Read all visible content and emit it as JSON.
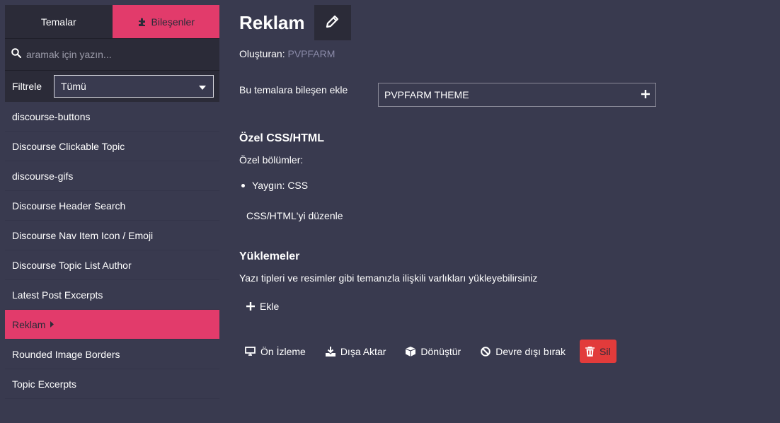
{
  "sidebar": {
    "tabs": {
      "themes": "Temalar",
      "components": "Bileşenler"
    },
    "search": {
      "placeholder": "aramak için yazın..."
    },
    "filter": {
      "label": "Filtrele",
      "selected": "Tümü"
    },
    "items": [
      {
        "label": "discourse-buttons"
      },
      {
        "label": "Discourse Clickable Topic"
      },
      {
        "label": "discourse-gifs"
      },
      {
        "label": "Discourse Header Search"
      },
      {
        "label": "Discourse Nav Item Icon / Emoji"
      },
      {
        "label": "Discourse Topic List Author"
      },
      {
        "label": "Latest Post Excerpts"
      },
      {
        "label": "Reklam",
        "active": true
      },
      {
        "label": "Rounded Image Borders"
      },
      {
        "label": "Topic Excerpts"
      }
    ]
  },
  "main": {
    "title": "Reklam",
    "author_label": "Oluşturan:",
    "author_value": "PVPFARM",
    "add_to_themes_label": "Bu temalara bileşen ekle",
    "selected_theme": "PVPFARM THEME",
    "custom_section": {
      "heading": "Özel CSS/HTML",
      "subheading": "Özel bölümler:",
      "items": [
        "Yaygın: CSS"
      ],
      "edit_label": "CSS/HTML'yi düzenle"
    },
    "uploads": {
      "heading": "Yüklemeler",
      "description": "Yazı tipleri ve resimler gibi temanızla ilişkili varlıkları yükleyebilirsiniz",
      "add_label": "Ekle"
    },
    "actions": {
      "preview": "Ön İzleme",
      "export": "Dışa Aktar",
      "convert": "Dönüştür",
      "disable": "Devre dışı bırak",
      "delete": "Sil"
    }
  },
  "colors": {
    "background": "#393a4f",
    "panel": "#2b2b38",
    "accent": "#e23b6b",
    "danger": "#e23b3b",
    "muted": "#8a8aa8"
  }
}
